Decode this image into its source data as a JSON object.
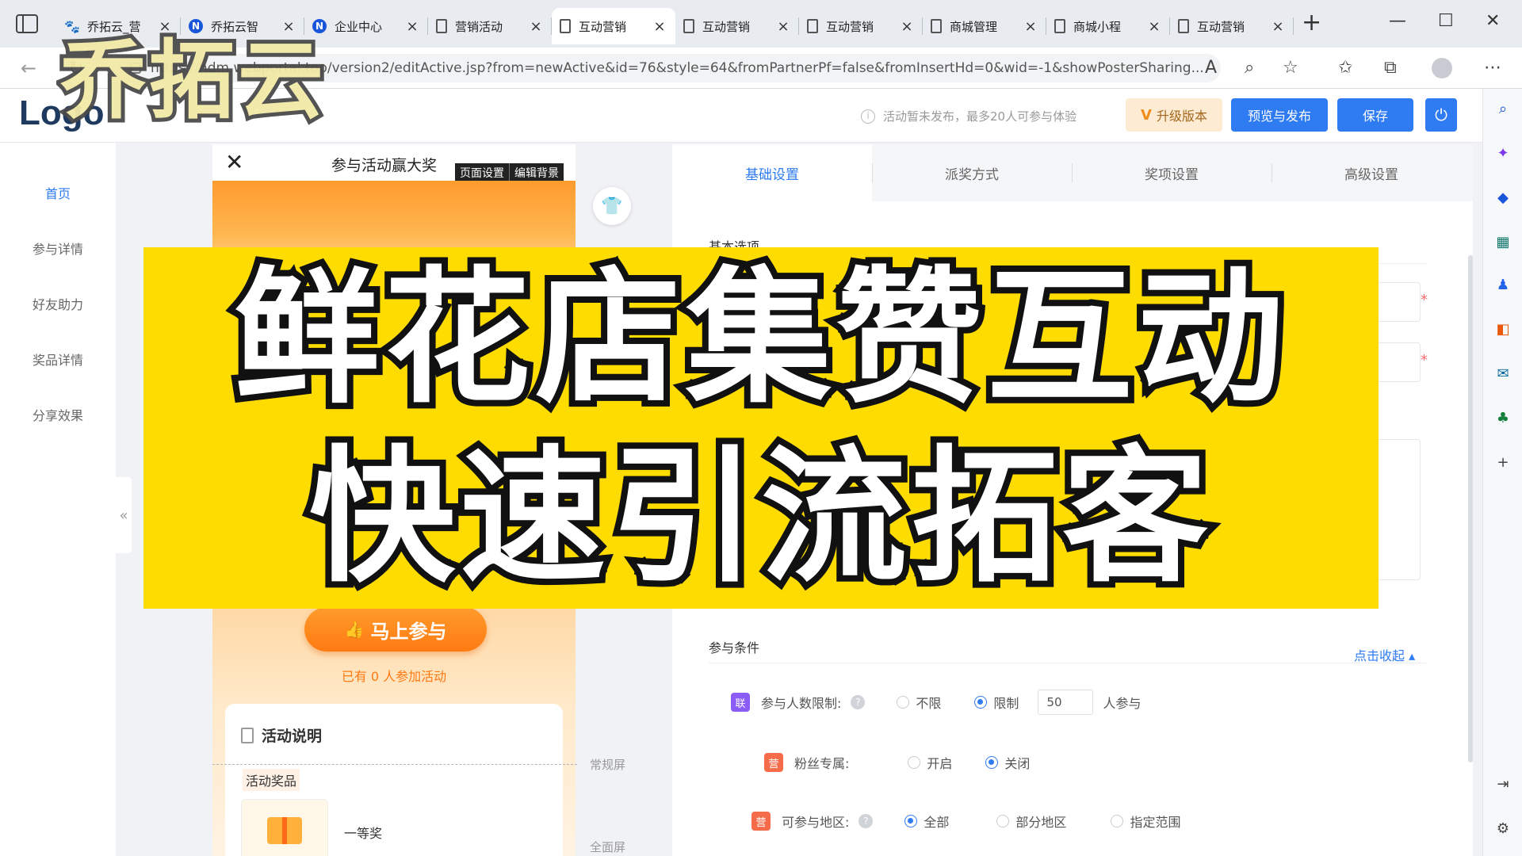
{
  "browser": {
    "tabs": [
      {
        "label": "乔拓云_营",
        "icon": "paw-icon",
        "active": false
      },
      {
        "label": "乔拓云智",
        "icon": "n-logo-icon",
        "active": false
      },
      {
        "label": "企业中心",
        "icon": "n-logo-icon",
        "active": false
      },
      {
        "label": "营销活动",
        "icon": "page-icon",
        "active": false
      },
      {
        "label": "互动营销",
        "icon": "page-icon",
        "active": true
      },
      {
        "label": "互动营销",
        "icon": "page-icon",
        "active": false
      },
      {
        "label": "互动营销",
        "icon": "page-icon",
        "active": false
      },
      {
        "label": "商城管理",
        "icon": "page-icon",
        "active": false
      },
      {
        "label": "商城小程",
        "icon": "page-icon",
        "active": false
      },
      {
        "label": "互动营销",
        "icon": "page-icon",
        "active": false
      }
    ],
    "url": "https://hdm.webportal.top/version2/editActive.jsp?from=newActive&id=76&style=64&fromPartnerPf=false&fromInsertHd=0&wid=-1&showPosterSharing..."
  },
  "header": {
    "logo": "Logo",
    "notice": "活动暂未发布，最多20人可参与体验",
    "upgrade_v": "V",
    "upgrade_label": "升级版本",
    "preview_label": "预览与发布",
    "save_label": "保存",
    "power_icon": "⏻"
  },
  "sidenav": {
    "items": [
      "首页",
      "参与详情",
      "好友助力",
      "奖品详情",
      "分享效果"
    ],
    "active_index": 0,
    "collapse_glyph": "«"
  },
  "phone": {
    "close_glyph": "✕",
    "title": "参与活动赢大奖",
    "page_setting": "页面设置",
    "edit_background": "编辑背景",
    "join_button": "马上参与",
    "joined_text": "已有 0 人参加活动",
    "desc_title": "活动说明",
    "prize_label": "活动奖品",
    "first_prize": "一等奖",
    "normal_screen_label": "常规屏",
    "full_screen_label": "全面屏"
  },
  "panel": {
    "tabs": [
      "基础设置",
      "派奖方式",
      "奖项设置",
      "高级设置"
    ],
    "active_tab": 0,
    "basic_section": "基本选项",
    "conditions_section": "参与条件",
    "collapse_link": "点击收起 ▴",
    "participant_limit": {
      "badge": "联",
      "label": "参与人数限制:",
      "options": [
        "不限",
        "限制"
      ],
      "selected": 1,
      "value": "50",
      "suffix": "人参与"
    },
    "fans_only": {
      "badge": "营",
      "label": "粉丝专属:",
      "options": [
        "开启",
        "关闭"
      ],
      "selected": 1
    },
    "region": {
      "badge": "营",
      "label": "可参与地区:",
      "options": [
        "全部",
        "部分地区",
        "指定范围"
      ],
      "selected": 0
    }
  },
  "overlay": {
    "watermark": "乔拓云",
    "headline_line1": "鲜花店集赞互动",
    "headline_line2": "快速引流拓客"
  },
  "colors": {
    "accent": "#2f7bf2",
    "banner_yellow": "#ffdc00",
    "orange": "#ff7a12"
  }
}
